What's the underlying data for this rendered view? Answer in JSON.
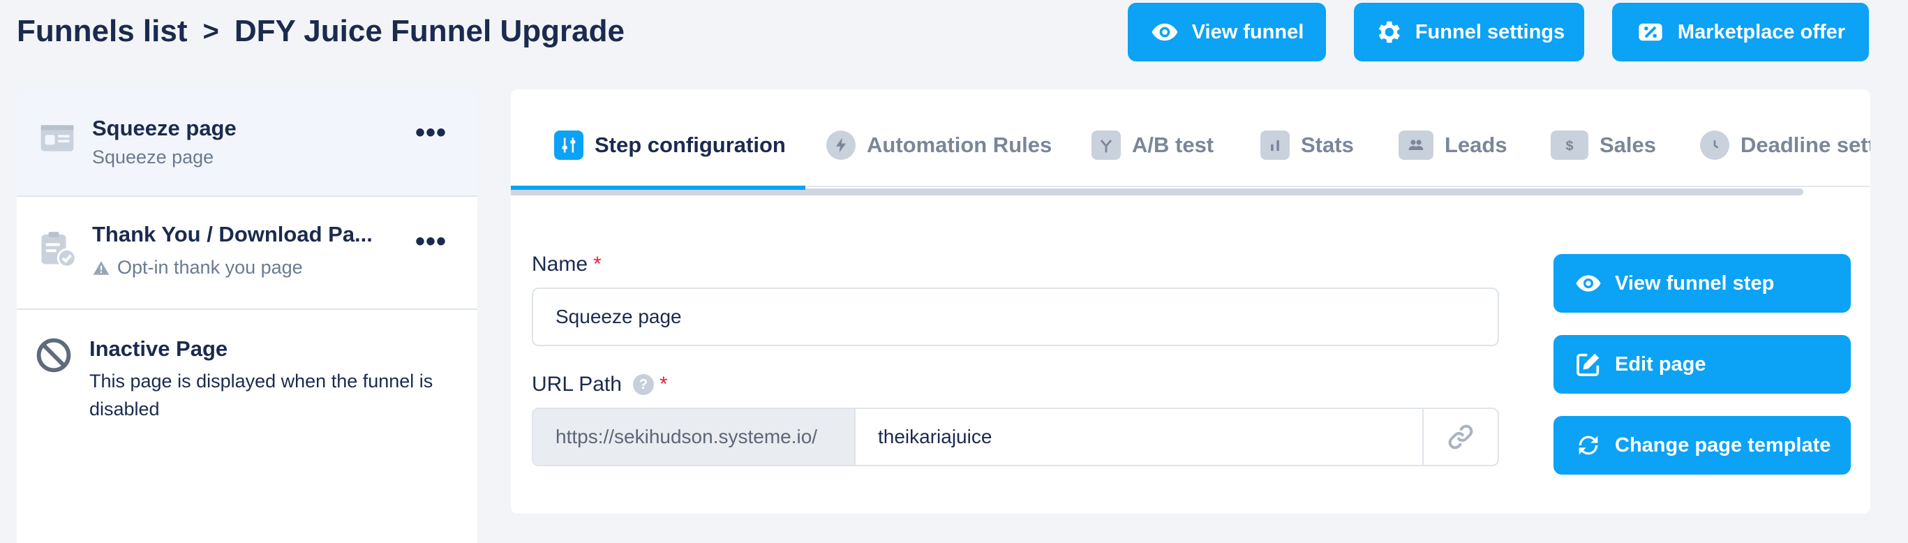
{
  "header": {
    "breadcrumb_root": "Funnels list",
    "breadcrumb_separator": ">",
    "breadcrumb_current": "DFY Juice Funnel Upgrade",
    "view_funnel_label": "View funnel",
    "funnel_settings_label": "Funnel settings",
    "marketplace_offer_label": "Marketplace offer"
  },
  "sidebar": {
    "items": [
      {
        "title": "Squeeze page",
        "subtitle": "Squeeze page",
        "menu": "•••",
        "icon": "web-page-icon"
      },
      {
        "title": "Thank You / Download Pa...",
        "subtitle": "Opt-in thank you page",
        "menu": "•••",
        "icon": "clipboard-check-icon"
      },
      {
        "title": "Inactive Page",
        "subtitle": "This page is displayed when the funnel is disabled",
        "icon": "prohibited-icon"
      }
    ]
  },
  "tabs": [
    {
      "label": "Step configuration",
      "icon": "sliders-icon"
    },
    {
      "label": "Automation Rules",
      "icon": "lightning-icon"
    },
    {
      "label": "A/B test",
      "icon": "split-icon"
    },
    {
      "label": "Stats",
      "icon": "bar-chart-icon"
    },
    {
      "label": "Leads",
      "icon": "users-icon"
    },
    {
      "label": "Sales",
      "icon": "dollar-icon"
    },
    {
      "label": "Deadline sett",
      "icon": "clock-icon"
    }
  ],
  "form": {
    "name_label": "Name",
    "name_value": "Squeeze page",
    "required_mark": "*",
    "url_label": "URL Path",
    "help_mark": "?",
    "url_prefix": "https://sekihudson.systeme.io/",
    "url_value": "theikariajuice"
  },
  "actions": {
    "view_step_label": "View funnel step",
    "edit_page_label": "Edit page",
    "change_template_label": "Change page template"
  },
  "colors": {
    "accent": "#0ca2f5",
    "text_dark": "#1b2a4e",
    "required": "#e5253d"
  }
}
